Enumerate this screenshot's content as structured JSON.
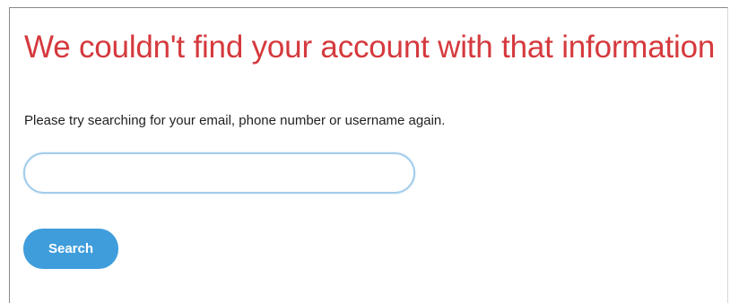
{
  "page": {
    "title": "We couldn't find your account with that information",
    "instructions": "Please try searching for your email, phone number or username again."
  },
  "search": {
    "value": "",
    "placeholder": ""
  },
  "actions": {
    "search_label": "Search"
  },
  "colors": {
    "title": "#d5393d",
    "button": "#3f9ddc",
    "input_border": "#a3cdea"
  }
}
